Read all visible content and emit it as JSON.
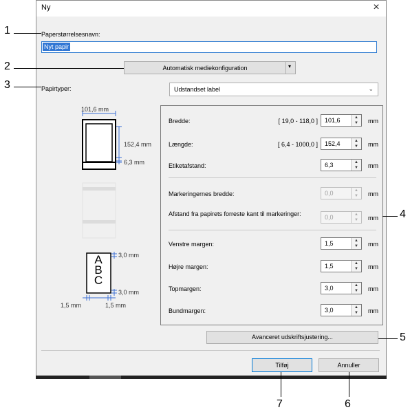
{
  "window": {
    "title": "Ny",
    "close_symbol": "×"
  },
  "paper_name": {
    "label": "Paperstørrelsesnavn:",
    "value": "Nyt papir"
  },
  "auto_media_button": "Automatisk mediekonfiguration",
  "paper_type": {
    "label": "Papirtyper:",
    "value": "Udstandset label"
  },
  "preview": {
    "width_dim": "101,6 mm",
    "length_dim": "152,4 mm",
    "gap_dim": "6,3 mm",
    "top_margin_dim": "3,0 mm",
    "bottom_margin_dim": "3,0 mm",
    "left_margin_dim": "1,5 mm",
    "right_margin_dim": "1,5 mm",
    "sample_letters": [
      "A",
      "B",
      "C"
    ]
  },
  "fields": [
    {
      "label": "Bredde:",
      "range": "[ 19,0 - 118,0 ]",
      "value": "101,6",
      "unit": "mm",
      "enabled": true
    },
    {
      "label": "Længde:",
      "range": "[ 6,4 - 1000,0 ]",
      "value": "152,4",
      "unit": "mm",
      "enabled": true
    },
    {
      "label": "Etiketafstand:",
      "range": "",
      "value": "6,3",
      "unit": "mm",
      "enabled": true
    },
    {
      "label": "Markeringernes bredde:",
      "range": "",
      "value": "0,0",
      "unit": "mm",
      "enabled": false
    },
    {
      "label": "Afstand fra papirets forreste kant til markeringer:",
      "range": "",
      "value": "0,0",
      "unit": "mm",
      "enabled": false
    },
    {
      "label": "Venstre margen:",
      "range": "",
      "value": "1,5",
      "unit": "mm",
      "enabled": true
    },
    {
      "label": "Højre margen:",
      "range": "",
      "value": "1,5",
      "unit": "mm",
      "enabled": true
    },
    {
      "label": "Topmargen:",
      "range": "",
      "value": "3,0",
      "unit": "mm",
      "enabled": true
    },
    {
      "label": "Bundmargen:",
      "range": "",
      "value": "3,0",
      "unit": "mm",
      "enabled": true
    }
  ],
  "advanced_button": "Avanceret udskriftsjustering...",
  "add_button": "Tilføj",
  "cancel_button": "Annuller",
  "callouts": [
    "1",
    "2",
    "3",
    "4",
    "5",
    "6",
    "7"
  ]
}
